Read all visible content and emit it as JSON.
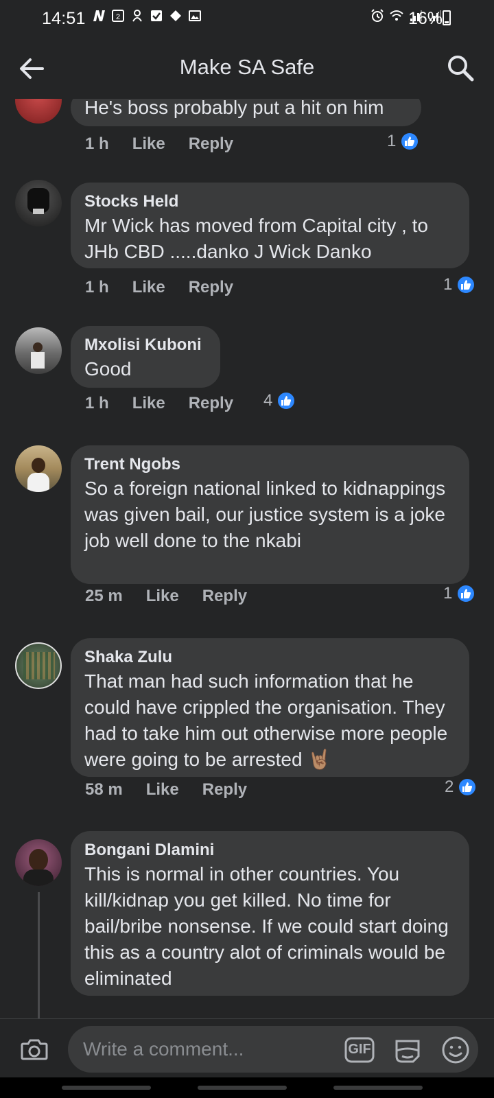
{
  "status_bar": {
    "time": "14:51",
    "battery": "16%",
    "left_icons": [
      "n-icon",
      "badge-2-icon",
      "vpn-icon",
      "checkbox-icon",
      "diamond-icon",
      "image-icon"
    ],
    "right_icons": [
      "alarm-icon",
      "wifi-icon",
      "signal-icon",
      "signal-icon"
    ]
  },
  "header": {
    "title": "Make SA Safe"
  },
  "comments": [
    {
      "author": "",
      "text": "He's boss probably put a hit on him",
      "time": "1 h",
      "like_label": "Like",
      "reply_label": "Reply",
      "reactions": "1"
    },
    {
      "author": "Stocks Held",
      "text": "Mr Wick has moved from Capital city , to JHb CBD .....danko J Wick Danko",
      "time": "1 h",
      "like_label": "Like",
      "reply_label": "Reply",
      "reactions": "1"
    },
    {
      "author": "Mxolisi Kuboni",
      "text": "Good",
      "time": "1 h",
      "like_label": "Like",
      "reply_label": "Reply",
      "reactions": "4"
    },
    {
      "author": "Trent Ngobs",
      "text": "So a foreign national linked to kidnappings was given bail, our justice system is a joke job well done to the nkabi",
      "time": "25 m",
      "like_label": "Like",
      "reply_label": "Reply",
      "reactions": "1"
    },
    {
      "author": "Shaka Zulu",
      "text": "That man had such information that he could have crippled the organisation. They had to take him out otherwise more people were going to be arrested 🤘🏽",
      "time": "58 m",
      "like_label": "Like",
      "reply_label": "Reply",
      "reactions": "2"
    },
    {
      "author": "Bongani Dlamini",
      "text": "This is normal in other countries. You kill/kidnap you get killed. No time for bail/bribe nonsense. If we could start doing this as a country alot of criminals would be eliminated"
    }
  ],
  "composer": {
    "placeholder": "Write a comment...",
    "gif_label": "GIF"
  },
  "colors": {
    "background": "#242526",
    "bubble": "#3a3b3c",
    "like_blue": "#2d88ff"
  }
}
